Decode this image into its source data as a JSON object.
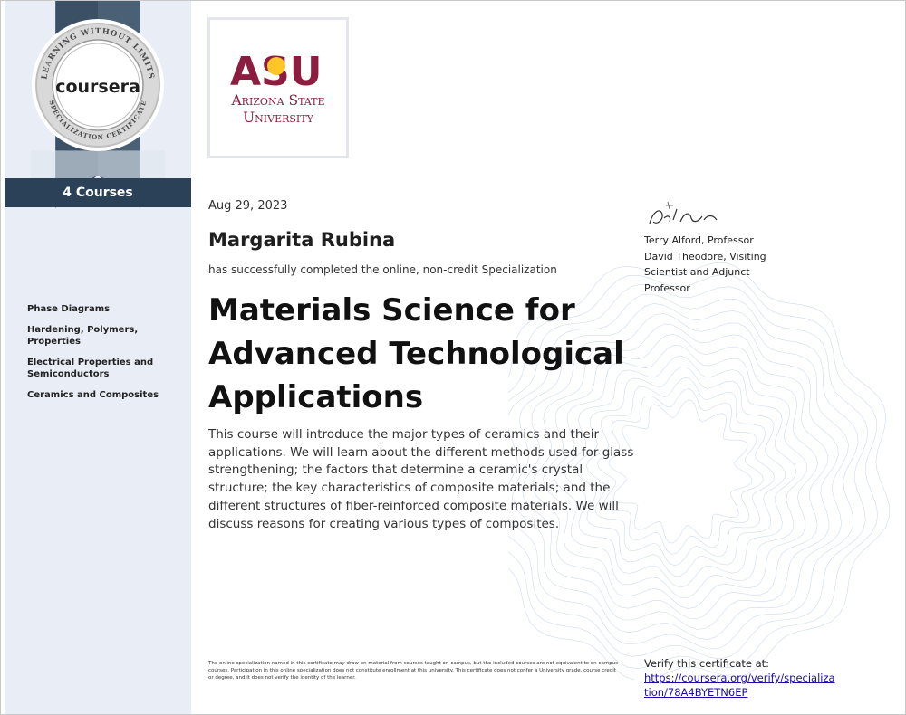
{
  "sidebar": {
    "seal_text_top": "LEARNING WITHOUT LIMITS",
    "seal_text_bottom": "SPECIALIZATION CERTIFICATE",
    "brand": "coursera",
    "course_count": "4 Courses",
    "courses": [
      "Phase Diagrams",
      "Hardening, Polymers, Properties",
      "Electrical Properties and Semiconductors",
      "Ceramics and Composites"
    ]
  },
  "logo": {
    "mark": "ASU",
    "line1": "Arizona State",
    "line2": "University",
    "color": "#8c1d40",
    "accent": "#ffc627"
  },
  "certificate": {
    "date": "Aug 29, 2023",
    "recipient": "Margarita Rubina",
    "completed_text": "has successfully completed the online, non-credit Specialization",
    "title": "Materials Science for Advanced Technological Applications",
    "description": "This course will introduce the major types of ceramics and their applications. We will learn about the different methods used for glass strengthening; the factors that determine a ceramic's crystal structure; the key characteristics of composite materials; and the different structures of fiber-reinforced composite materials. We will discuss reasons for creating various types of composites."
  },
  "signers": [
    "Terry Alford, Professor",
    "David Theodore, Visiting Scientist and Adjunct Professor"
  ],
  "fine_print": "The online specialization named in this certificate may draw on material from courses taught on-campus, but the included courses are not equivalent to on-campus courses. Participation in this online specialization does not constitute enrollment at this university. This certificate does not confer a University grade, course credit or degree, and it does not verify the identity of the learner.",
  "verify": {
    "label": "Verify this certificate at:",
    "url": "https://coursera.org/verify/specialization/78A4BYETN6EP"
  },
  "colors": {
    "sidebar_bg": "#e9eef6",
    "ribbon_dark": "#2a4158",
    "link": "#1a0dab"
  }
}
